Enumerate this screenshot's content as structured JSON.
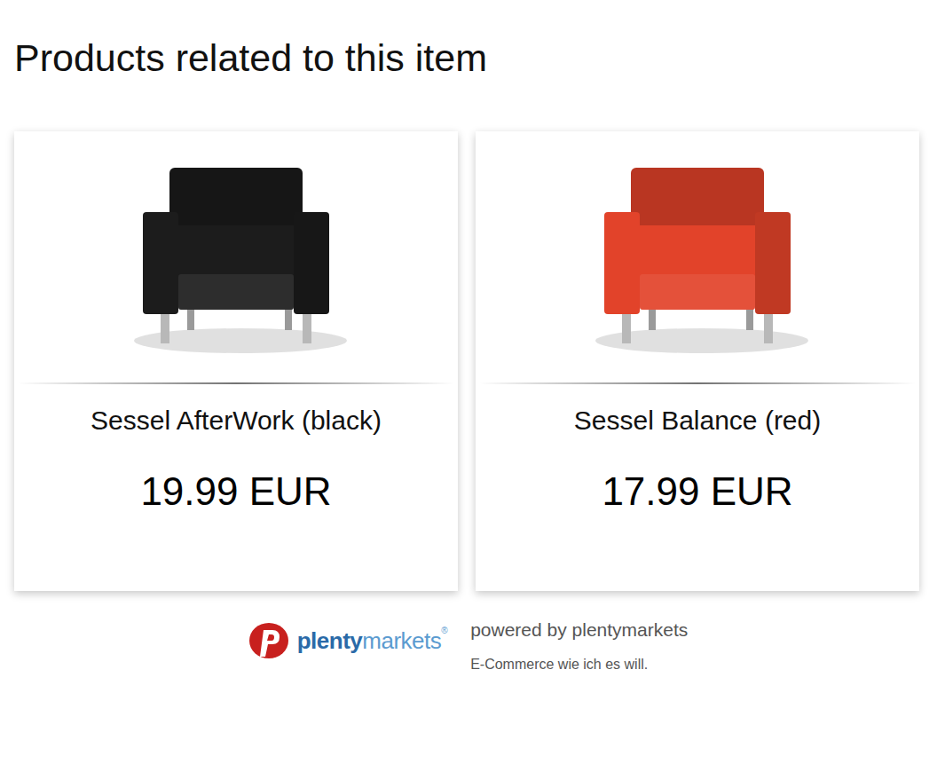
{
  "heading": "Products related to this item",
  "products": [
    {
      "name": "Sessel AfterWork (black)",
      "price": "19.99 EUR",
      "color": "#1c1c1c"
    },
    {
      "name": "Sessel Balance (red)",
      "price": "17.99 EUR",
      "color": "#e2432a"
    }
  ],
  "footer": {
    "logo": {
      "primary": "plenty",
      "secondary": "markets",
      "mark": "®"
    },
    "powered": "powered by plentymarkets",
    "tagline": "E-Commerce wie ich es will."
  }
}
